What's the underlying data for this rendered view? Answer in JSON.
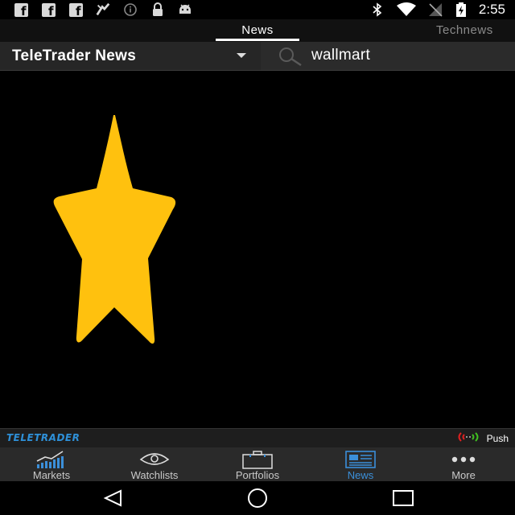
{
  "status_bar": {
    "left_icons": [
      "facebook-icon",
      "facebook-icon",
      "facebook-icon",
      "fanatic-app-icon",
      "info-icon",
      "lock-icon",
      "android-icon"
    ],
    "right_icons": [
      "bluetooth-icon",
      "wifi-icon",
      "no-signal-icon",
      "battery-charging-icon"
    ],
    "time": "2:55"
  },
  "tabs": [
    {
      "label": "News",
      "active": true
    },
    {
      "label": "Technews",
      "active": false
    }
  ],
  "toolbar": {
    "source_label": "TeleTrader News",
    "search_value": "wallmart"
  },
  "content": {
    "image": "star-icon",
    "star_color": "#FFC10E"
  },
  "brand_bar": {
    "logo_text": "TELETRADER",
    "push_label": "Push",
    "logo_color": "#2e90d8"
  },
  "bottom_nav": [
    {
      "label": "Markets",
      "icon": "markets-chart-icon",
      "active": false
    },
    {
      "label": "Watchlists",
      "icon": "eye-icon",
      "active": false
    },
    {
      "label": "Portfolios",
      "icon": "briefcase-icon",
      "active": false
    },
    {
      "label": "News",
      "icon": "newspaper-icon",
      "active": true
    },
    {
      "label": "More",
      "icon": "more-dots-icon",
      "active": false
    }
  ],
  "colors": {
    "accent": "#3b8fd9",
    "background": "#000000",
    "toolbar": "#262626"
  }
}
